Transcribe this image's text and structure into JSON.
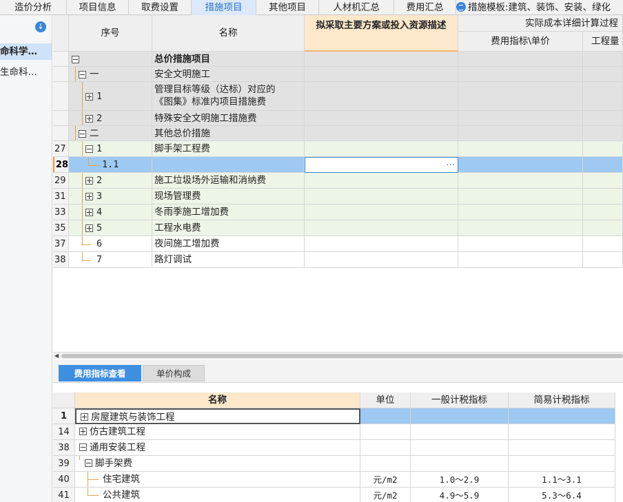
{
  "top_tabs": [
    {
      "label": "造价分析"
    },
    {
      "label": "项目信息"
    },
    {
      "label": "取费设置"
    },
    {
      "label": "措施项目"
    },
    {
      "label": "其他项目"
    },
    {
      "label": "人材机汇总"
    },
    {
      "label": "费用汇总"
    }
  ],
  "active_tab": "措施项目",
  "template_label": "措施模板:建筑、装饰、安装、绿化",
  "left_panel": {
    "items": [
      {
        "label": "命科学…",
        "selected": true
      },
      {
        "label": "生命科…",
        "selected": false
      }
    ]
  },
  "main_grid": {
    "headers": {
      "seq": "序号",
      "name": "名称",
      "desc": "拟采取主要方案或投入资源描述",
      "group": "实际成本详细计算过程",
      "cost_index": "费用指标\\单价",
      "quantity": "工程量"
    },
    "rows": [
      {
        "num": "",
        "seq": "",
        "name": "总价措施项目"
      },
      {
        "num": "",
        "seq": "一",
        "name": "安全文明施工"
      },
      {
        "num": "",
        "seq": "1",
        "name": "管理目标等级（达标）对应的《图集》标准内项目措施费"
      },
      {
        "num": "",
        "seq": "2",
        "name": "特殊安全文明施工措施费"
      },
      {
        "num": "",
        "seq": "二",
        "name": "其他总价措施"
      },
      {
        "num": "27",
        "seq": "1",
        "name": "脚手架工程费"
      },
      {
        "num": "28",
        "seq": "1.1",
        "name": ""
      },
      {
        "num": "29",
        "seq": "2",
        "name": "施工垃圾场外运输和消纳费"
      },
      {
        "num": "31",
        "seq": "3",
        "name": "现场管理费"
      },
      {
        "num": "33",
        "seq": "4",
        "name": "冬雨季施工增加费"
      },
      {
        "num": "35",
        "seq": "5",
        "name": "工程水电费"
      },
      {
        "num": "37",
        "seq": "6",
        "name": "夜间施工增加费"
      },
      {
        "num": "38",
        "seq": "7",
        "name": "路灯调试"
      }
    ],
    "name_line1": "管理目标等级（达标）对应的",
    "name_line2": "《图集》标准内项目措施费",
    "edit_ellipsis": "···"
  },
  "bottom_tabs": [
    {
      "label": "费用指标查看"
    },
    {
      "label": "单价构成"
    }
  ],
  "bottom_grid": {
    "headers": {
      "name": "名称",
      "unit": "单位",
      "general": "一般计税指标",
      "simple": "简易计税指标"
    },
    "rows": [
      {
        "num": "1",
        "name": "房屋建筑与装饰工程",
        "unit": "",
        "general": "",
        "simple": ""
      },
      {
        "num": "14",
        "name": "仿古建筑工程",
        "unit": "",
        "general": "",
        "simple": ""
      },
      {
        "num": "38",
        "name": "通用安装工程",
        "unit": "",
        "general": "",
        "simple": ""
      },
      {
        "num": "39",
        "name": "脚手架费",
        "unit": "",
        "general": "",
        "simple": ""
      },
      {
        "num": "40",
        "name": "住宅建筑",
        "unit": "元/m2",
        "general": "1.0～2.9",
        "simple": "1.1～3.1"
      },
      {
        "num": "41",
        "name": "公共建筑",
        "unit": "元/m2",
        "general": "4.9～5.9",
        "simple": "5.3～6.4"
      }
    ]
  },
  "colors": {
    "accent": "#3e8fe0",
    "selected_row": "#9dc9f2",
    "group_row": "#e2e2e2",
    "green_row": "#ecf5e6",
    "header_highlight": "#fde8cb",
    "tree_line": "#e2a54c"
  }
}
